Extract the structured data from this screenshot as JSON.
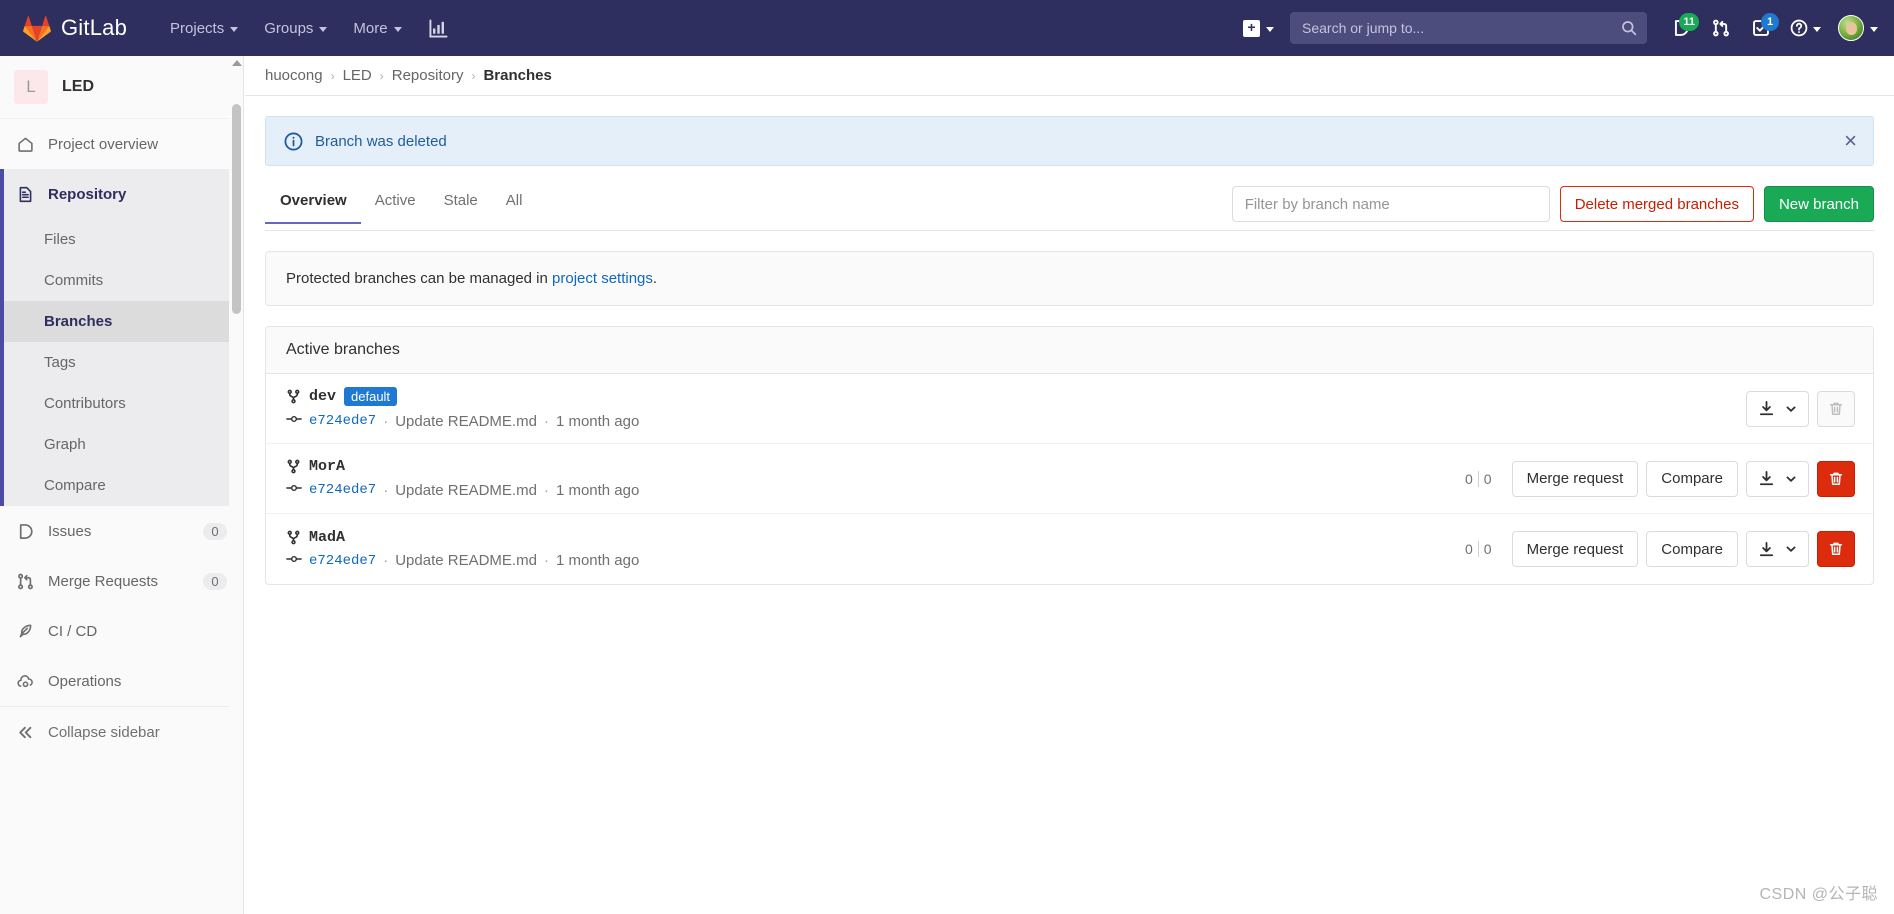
{
  "navbar": {
    "brand": "GitLab",
    "logo_icon": "gitlab-tanuki-icon",
    "items": [
      {
        "label": "Projects",
        "icon": "chevron-down-icon"
      },
      {
        "label": "Groups",
        "icon": "chevron-down-icon"
      },
      {
        "label": "More",
        "icon": "chevron-down-icon"
      }
    ],
    "analytics_icon": "chart-bar-icon",
    "create_new": {
      "icon": "plus-square-icon",
      "caret": "chevron-down-icon"
    },
    "search": {
      "placeholder": "Search or jump to...",
      "value": "",
      "icon": "search-icon"
    },
    "issues": {
      "icon": "issues-icon",
      "count": "11",
      "color": "#1aaa55"
    },
    "merge_requests": {
      "icon": "merge-request-icon",
      "count": ""
    },
    "todos": {
      "icon": "todo-done-icon",
      "count": "1",
      "color": "#1f78d1"
    },
    "help": {
      "icon": "question-circle-icon",
      "caret": "chevron-down-icon"
    },
    "user": {
      "icon": "avatar-icon",
      "caret": "chevron-down-icon"
    }
  },
  "sidebar": {
    "project": {
      "initial": "L",
      "name": "LED"
    },
    "items": [
      {
        "label": "Project overview",
        "icon": "home-icon",
        "badge": ""
      },
      {
        "label": "Repository",
        "icon": "document-icon",
        "badge": ""
      }
    ],
    "repository_subitems": [
      {
        "label": "Files"
      },
      {
        "label": "Commits"
      },
      {
        "label": "Branches"
      },
      {
        "label": "Tags"
      },
      {
        "label": "Contributors"
      },
      {
        "label": "Graph"
      },
      {
        "label": "Compare"
      }
    ],
    "active_subitem": "Branches",
    "lower_items": [
      {
        "label": "Issues",
        "icon": "issues-icon",
        "badge": "0"
      },
      {
        "label": "Merge Requests",
        "icon": "merge-request-icon",
        "badge": "0"
      },
      {
        "label": "CI / CD",
        "icon": "rocket-icon",
        "badge": ""
      },
      {
        "label": "Operations",
        "icon": "cloud-gear-icon",
        "badge": ""
      }
    ],
    "collapse": {
      "label": "Collapse sidebar",
      "icon": "double-chevron-left-icon"
    }
  },
  "breadcrumb": {
    "items": [
      "huocong",
      "LED",
      "Repository",
      "Branches"
    ],
    "separator": "›"
  },
  "alert": {
    "icon": "info-circle-icon",
    "message": "Branch was deleted",
    "close_icon": "close-icon"
  },
  "tabs": [
    {
      "label": "Overview",
      "active": true
    },
    {
      "label": "Active",
      "active": false
    },
    {
      "label": "Stale",
      "active": false
    },
    {
      "label": "All",
      "active": false
    }
  ],
  "toolbar": {
    "filter_placeholder": "Filter by branch name",
    "filter_value": "",
    "delete_merged_label": "Delete merged branches",
    "new_branch_label": "New branch",
    "danger_color": "#dd2b0e",
    "success_color": "#1aaa55"
  },
  "protected_note": {
    "prefix": "Protected branches can be managed in ",
    "link": "project settings",
    "suffix": "."
  },
  "panel": {
    "heading": "Active branches"
  },
  "branches": [
    {
      "name": "dev",
      "badge": "default",
      "badge_color": "#1f78d1",
      "commit_sha": "e724ede7",
      "commit_message": "Update README.md",
      "commit_time": "1 month ago",
      "behind": "",
      "ahead": "",
      "show_divergence": false,
      "actions": [
        "download",
        "delete"
      ],
      "merge_request_label": "Merge request",
      "compare_label": "Compare",
      "delete_enabled": false
    },
    {
      "name": "MorA",
      "badge": "",
      "badge_color": "",
      "commit_sha": "e724ede7",
      "commit_message": "Update README.md",
      "commit_time": "1 month ago",
      "behind": "0",
      "ahead": "0",
      "show_divergence": true,
      "actions": [
        "merge_request",
        "compare",
        "download",
        "delete"
      ],
      "merge_request_label": "Merge request",
      "compare_label": "Compare",
      "delete_enabled": true
    },
    {
      "name": "MadA",
      "badge": "",
      "badge_color": "",
      "commit_sha": "e724ede7",
      "commit_message": "Update README.md",
      "commit_time": "1 month ago",
      "behind": "0",
      "ahead": "0",
      "show_divergence": true,
      "actions": [
        "merge_request",
        "compare",
        "download",
        "delete"
      ],
      "merge_request_label": "Merge request",
      "compare_label": "Compare",
      "delete_enabled": true
    }
  ],
  "icons": {
    "branch": "branch-icon",
    "commit": "commit-icon",
    "download": "download-icon",
    "trash": "trash-icon",
    "chevron_down": "chevron-down-icon"
  },
  "watermark": "CSDN @公子聪"
}
